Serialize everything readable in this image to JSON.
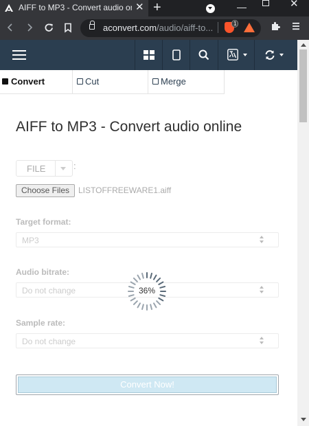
{
  "browser": {
    "tab_title": "AIFF to MP3 - Convert audio online",
    "tab_close": "✕",
    "new_tab": "+",
    "url_host": "aconvert.com",
    "url_path": "/audio/aiff-to...",
    "brave_shield_count": "1",
    "icons": {
      "back": "back-arrow-icon",
      "forward": "forward-arrow-icon",
      "reload": "reload-icon",
      "bookmark": "bookmark-icon",
      "lock": "lock-icon",
      "brave": "brave-shield-icon",
      "rewards": "brave-rewards-icon",
      "extensions": "puzzle-icon",
      "menu": "menu-icon"
    }
  },
  "site_nav": {
    "icons": [
      "hamburger-icon",
      "grid-icon",
      "tablet-icon",
      "search-icon",
      "language-icon",
      "refresh-icon"
    ]
  },
  "subtabs": [
    {
      "label": "Convert",
      "active": true
    },
    {
      "label": "Cut",
      "active": false
    },
    {
      "label": "Merge",
      "active": false
    }
  ],
  "main": {
    "title": "AIFF to MP3 - Convert audio online",
    "file_source": "FILE",
    "file_source_suffix": ":",
    "choose_files_label": "Choose Files",
    "selected_file": "LISTOFFREEWARE1.aiff",
    "target_format": {
      "label": "Target format:",
      "value": "MP3"
    },
    "audio_bitrate": {
      "label": "Audio bitrate:",
      "value": "Do not change"
    },
    "sample_rate": {
      "label": "Sample rate:",
      "value": "Do not change"
    },
    "progress": {
      "value": 0.36,
      "label": "36%"
    },
    "convert_button": "Convert Now!"
  },
  "colors": {
    "nav_bg": "#2b3e50",
    "chrome_bg": "#35363a",
    "convert_btn_bg": "#cfe8f3"
  }
}
